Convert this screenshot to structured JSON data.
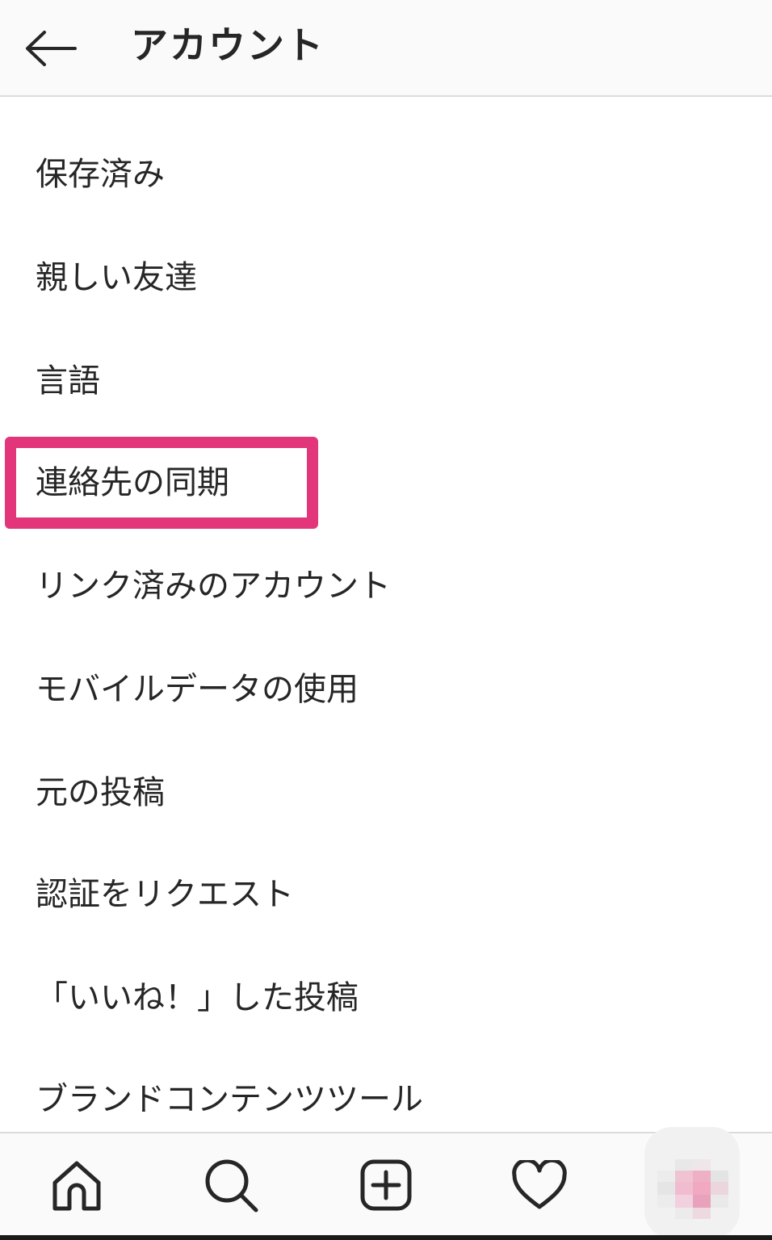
{
  "header": {
    "title": "アカウント",
    "back_icon": "arrow-left-icon"
  },
  "menu": {
    "items": [
      {
        "label": "保存済み"
      },
      {
        "label": "親しい友達"
      },
      {
        "label": "言語"
      },
      {
        "label": "連絡先の同期"
      },
      {
        "label": "リンク済みのアカウント"
      },
      {
        "label": "モバイルデータの使用"
      },
      {
        "label": "元の投稿"
      },
      {
        "label": "認証をリクエスト"
      },
      {
        "label": "「いいね！」した投稿"
      },
      {
        "label": "ブランドコンテンツツール"
      }
    ],
    "highlighted_item": "連絡先の同期",
    "highlight_color": "#e2357a"
  },
  "tabs": [
    {
      "name": "home",
      "icon": "home-icon"
    },
    {
      "name": "search",
      "icon": "search-icon"
    },
    {
      "name": "new-post",
      "icon": "add-post-icon"
    },
    {
      "name": "activity",
      "icon": "heart-icon"
    },
    {
      "name": "profile",
      "icon": "avatar-pixelated"
    }
  ],
  "colors": {
    "text": "#262626",
    "header_bg": "#fafafa",
    "divider": "#dbdbdb",
    "accent": "#e2357a"
  }
}
